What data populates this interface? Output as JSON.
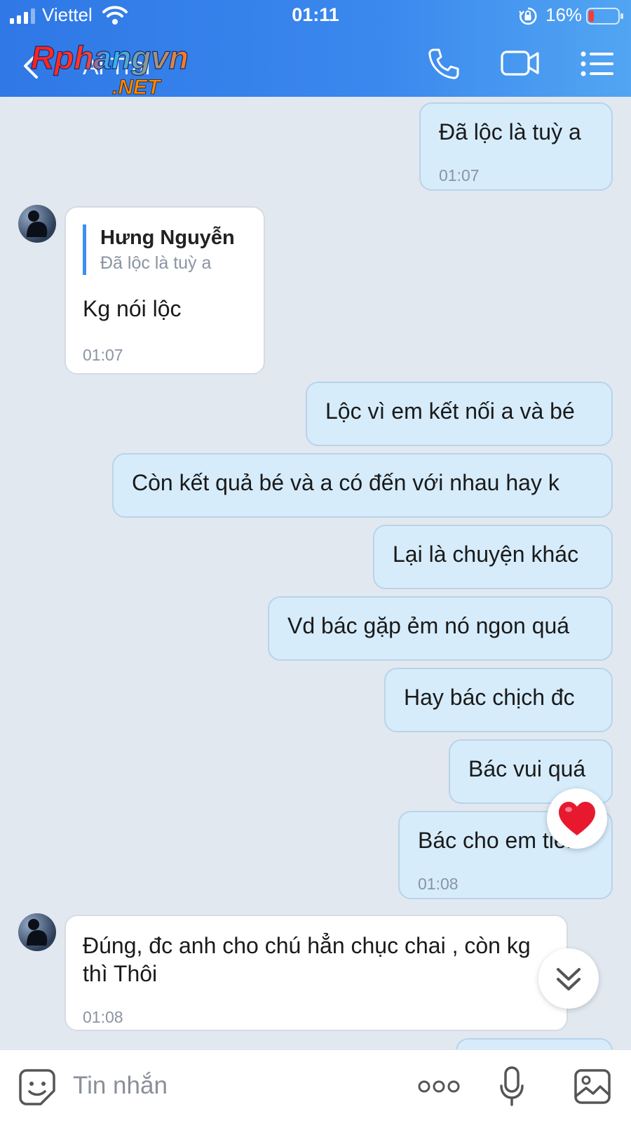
{
  "status_bar": {
    "carrier": "Viettel",
    "time": "01:11",
    "battery_percent": "16%"
  },
  "header": {
    "contact_name": "Ai Trai",
    "watermark_top": "Rphangvn",
    "watermark_bottom": ".NET",
    "icons": [
      "back-icon",
      "phone-icon",
      "video-icon",
      "menu-icon"
    ]
  },
  "messages": [
    {
      "id": "m1",
      "direction": "out",
      "text": "Đã lộc là tuỳ a",
      "time": "01:07"
    },
    {
      "id": "m2",
      "direction": "in",
      "quote_author": "Hưng Nguyễn",
      "quote_text": "Đã lộc là tuỳ a",
      "text": "Kg nói lộc",
      "time": "01:07"
    },
    {
      "id": "m3",
      "direction": "out",
      "text": "Lộc vì em kết nối a và bé"
    },
    {
      "id": "m4",
      "direction": "out",
      "text": "Còn kết quả bé và a có đến với nhau hay k"
    },
    {
      "id": "m5",
      "direction": "out",
      "text": "Lại là chuyện khác"
    },
    {
      "id": "m6",
      "direction": "out",
      "text": "Vd bác gặp ẻm nó ngon quá"
    },
    {
      "id": "m7",
      "direction": "out",
      "text": "Hay bác chịch đc"
    },
    {
      "id": "m8",
      "direction": "out",
      "text": "Bác vui quá"
    },
    {
      "id": "m9",
      "direction": "out",
      "text": "Bác cho em tiền",
      "time": "01:08",
      "reaction": "heart"
    },
    {
      "id": "m10",
      "direction": "in",
      "text": "Đúng, đc anh cho chú hẳn chục chai , còn kg thì Thôi",
      "time": "01:08"
    }
  ],
  "input_bar": {
    "placeholder": "Tin nhắn",
    "icons": [
      "sticker-icon",
      "more-icon",
      "mic-icon",
      "image-icon"
    ]
  },
  "colors": {
    "header_start": "#2f78e6",
    "header_end": "#52a5f2",
    "outgoing_bubble": "#d6ecfb",
    "incoming_bubble": "#ffffff",
    "chat_background": "#e2e8f0",
    "quote_bar": "#3f8ff0",
    "battery_low": "#ff3b30"
  }
}
